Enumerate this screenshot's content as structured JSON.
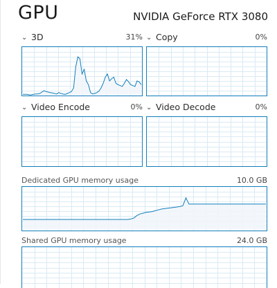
{
  "header": {
    "title": "GPU",
    "device_name": "NVIDIA GeForce RTX 3080"
  },
  "engines": [
    {
      "name": "3D",
      "percent": "31%"
    },
    {
      "name": "Copy",
      "percent": "0%"
    },
    {
      "name": "Video Encode",
      "percent": "0%"
    },
    {
      "name": "Video Decode",
      "percent": "0%"
    }
  ],
  "memory": {
    "dedicated": {
      "label": "Dedicated GPU memory usage",
      "value": "10.0 GB"
    },
    "shared": {
      "label": "Shared GPU memory usage",
      "value": "24.0 GB"
    }
  },
  "colors": {
    "line": "#117dbb",
    "fill": "#f1f6fa",
    "grid": "#d9eaf4"
  },
  "chart_data": [
    {
      "type": "area",
      "series": [
        {
          "values": [
            1,
            1,
            1,
            0,
            0,
            1,
            2,
            2,
            3,
            6,
            9,
            7,
            6,
            5,
            4,
            3,
            2,
            5,
            3,
            2,
            1,
            3,
            5,
            7,
            15,
            60,
            82,
            78,
            45,
            55,
            30,
            22,
            5,
            2,
            3,
            5,
            8,
            15,
            25,
            38,
            45,
            30,
            35,
            38,
            25,
            22,
            20,
            18,
            25,
            33,
            28,
            22,
            20,
            18,
            30,
            28,
            22
          ]
        }
      ],
      "ylim": [
        0,
        100
      ]
    },
    {
      "type": "area",
      "series": [
        {
          "values": [
            0,
            0,
            0,
            0,
            0,
            0,
            0,
            0,
            0,
            0
          ]
        }
      ],
      "ylim": [
        0,
        100
      ]
    },
    {
      "type": "area",
      "series": [
        {
          "values": [
            0,
            0,
            0,
            0,
            0,
            0,
            0,
            0,
            0,
            0
          ]
        }
      ],
      "ylim": [
        0,
        100
      ]
    },
    {
      "type": "area",
      "series": [
        {
          "values": [
            0,
            0,
            0,
            0,
            0,
            0,
            0,
            0,
            0,
            0
          ]
        }
      ],
      "ylim": [
        0,
        100
      ]
    },
    {
      "type": "area",
      "series": [
        {
          "values": [
            2.5,
            2.5,
            2.5,
            2.5,
            2.5,
            2.5,
            2.5,
            2.5,
            2.5,
            2.5,
            2.5,
            2.5,
            2.5,
            2.5,
            2.5,
            2.5,
            2.5,
            2.5,
            2.5,
            2.5,
            2.5,
            2.5,
            2.5,
            2.5,
            2.5,
            2.5,
            2.5,
            2.5,
            2.5,
            2.5,
            2.5,
            2.5,
            2.5,
            2.5,
            2.5,
            2.6,
            2.8,
            3.4,
            3.8,
            4.0,
            4.2,
            4.3,
            4.4,
            4.6,
            4.8,
            5.0,
            5.1,
            5.2,
            5.3,
            5.4,
            5.5,
            5.6,
            5.8,
            7.7,
            6.2,
            6.2,
            6.2,
            6.2,
            6.2,
            6.2,
            6.2,
            6.2,
            6.2,
            6.2,
            6.2,
            6.2,
            6.2,
            6.2,
            6.2,
            6.2,
            6.2,
            6.2,
            6.2,
            6.2,
            6.2,
            6.2,
            6.2,
            6.2,
            6.2,
            6.2
          ]
        }
      ],
      "ylim": [
        0,
        10.0
      ]
    },
    {
      "type": "area",
      "series": [
        {
          "values": [
            0,
            0,
            0,
            0,
            0,
            0,
            0,
            0,
            0,
            0
          ]
        }
      ],
      "ylim": [
        0,
        24.0
      ]
    }
  ]
}
